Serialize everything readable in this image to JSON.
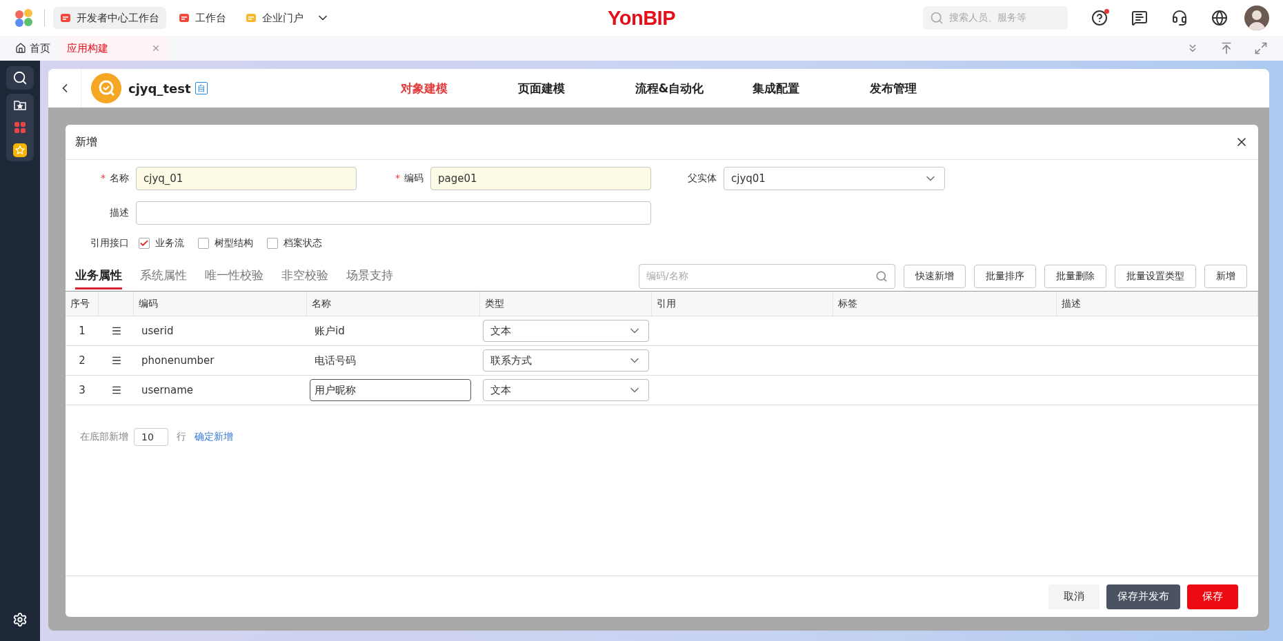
{
  "top_bar": {
    "logo": "YonBIP",
    "workspaces": [
      {
        "label": "开发者中心工作台",
        "selected": true,
        "color": "#f0493e"
      },
      {
        "label": "工作台",
        "selected": false,
        "color": "#f0493e"
      },
      {
        "label": "企业门户",
        "selected": false,
        "color": "#f5b82e"
      }
    ],
    "search": {
      "placeholder": "搜索人员、服务等"
    },
    "help_unread": true
  },
  "page_tabs": [
    {
      "label": "首页",
      "selected": false
    },
    {
      "label": "应用构建",
      "selected": true
    }
  ],
  "app": {
    "name": "cjyq_test",
    "badge": "自",
    "nav": [
      {
        "label": "对象建模",
        "selected": true
      },
      {
        "label": "页面建模",
        "selected": false
      },
      {
        "label": "流程&自动化",
        "selected": false
      },
      {
        "label": "集成配置",
        "selected": false
      },
      {
        "label": "发布管理",
        "selected": false
      }
    ]
  },
  "dialog": {
    "title": "新增",
    "required_mark": "*",
    "form_rows": [
      [
        {
          "label": "名称",
          "required": true,
          "value": "cjyq_01",
          "kind": "text"
        },
        {
          "label": "编码",
          "required": true,
          "value": "page01",
          "kind": "text"
        },
        {
          "label": "父实体",
          "required": false,
          "value": "cjyq01",
          "kind": "select"
        }
      ],
      [
        {
          "label": "描述",
          "required": false,
          "kind": "text"
        }
      ]
    ],
    "interfaces": {
      "label": "引用接口",
      "options": [
        {
          "label": "业务流",
          "checked": true
        },
        {
          "label": "树型结构",
          "checked": false
        },
        {
          "label": "档案状态",
          "checked": false
        }
      ]
    },
    "tabs": [
      {
        "label": "业务属性",
        "selected": true
      },
      {
        "label": "系统属性",
        "selected": false
      },
      {
        "label": "唯一性校验",
        "selected": false
      },
      {
        "label": "非空校验",
        "selected": false
      },
      {
        "label": "场景支持",
        "selected": false
      }
    ],
    "search": {
      "placeholder": "编码/名称"
    },
    "toolbar": [
      "快速新增",
      "批量排序",
      "批量删除",
      "批量设置类型",
      "新增"
    ],
    "table": {
      "columns": [
        "序号",
        "编码",
        "名称",
        "类型",
        "引用",
        "标签",
        "描述"
      ],
      "rows": [
        {
          "index": "1",
          "code": "userid",
          "name": "账户id",
          "type": "文本",
          "editing": false
        },
        {
          "index": "2",
          "code": "phonenumber",
          "name": "电话号码",
          "type": "联系方式",
          "editing": false
        },
        {
          "index": "3",
          "code": "username",
          "name": "用户昵称",
          "type": "文本",
          "editing": true
        }
      ]
    },
    "bulk_add": {
      "prefix": "在底部新增",
      "count": "10",
      "suffix": "行",
      "link": "确定新增"
    },
    "actions": [
      {
        "label": "取消",
        "kind": "cancel"
      },
      {
        "label": "保存并发布",
        "kind": "publish"
      },
      {
        "label": "保存",
        "kind": "save"
      }
    ]
  }
}
